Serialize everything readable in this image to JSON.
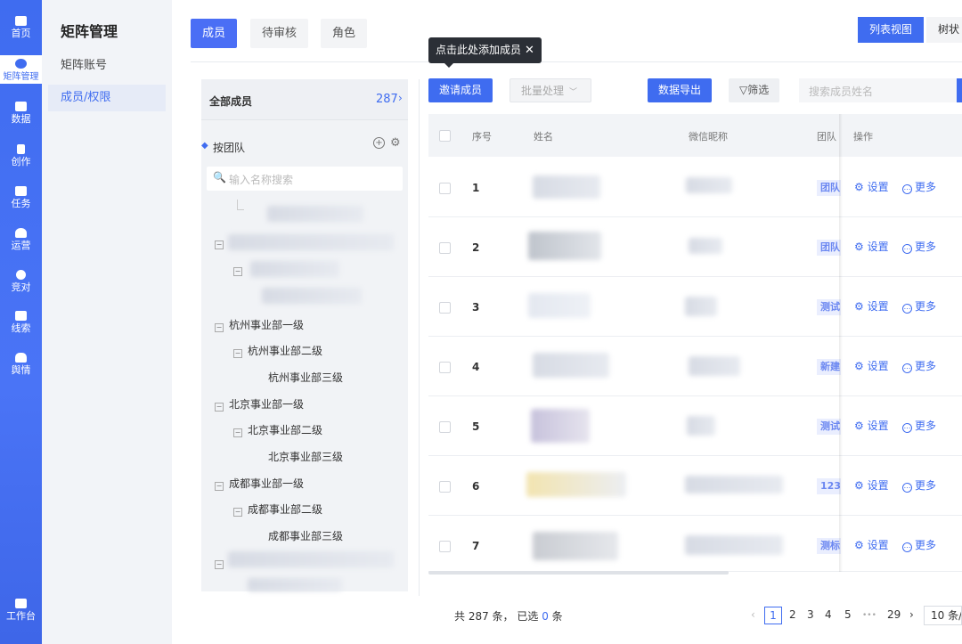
{
  "rail": {
    "items": [
      {
        "label": "首页",
        "icon": "home-icon"
      },
      {
        "label": "矩阵管理",
        "icon": "matrix-icon"
      },
      {
        "label": "数据",
        "icon": "data-icon"
      },
      {
        "label": "创作",
        "icon": "create-icon"
      },
      {
        "label": "任务",
        "icon": "task-icon"
      },
      {
        "label": "运营",
        "icon": "operation-icon"
      },
      {
        "label": "竞对",
        "icon": "compete-icon"
      },
      {
        "label": "线索",
        "icon": "leads-icon"
      },
      {
        "label": "舆情",
        "icon": "opinion-icon"
      }
    ],
    "workbench": "工作台"
  },
  "subnav": {
    "title": "矩阵管理",
    "items": [
      "矩阵账号",
      "成员/权限"
    ]
  },
  "tabs": [
    "成员",
    "待审核",
    "角色"
  ],
  "views": {
    "list": "列表视图",
    "tree": "树状视"
  },
  "tree": {
    "all_label": "全部成员",
    "all_count": "287",
    "group_label": "按团队",
    "search_placeholder": "输入名称搜索",
    "nodes": [
      "杭州事业部一级",
      "杭州事业部二级",
      "杭州事业部三级",
      "北京事业部一级",
      "北京事业部二级",
      "北京事业部三级",
      "成都事业部一级",
      "成都事业部二级",
      "成都事业部三级"
    ]
  },
  "tooltip": "点击此处添加成员",
  "toolbar": {
    "invite": "邀请成员",
    "batch": "批量处理",
    "export": "数据导出",
    "filter": "筛选",
    "search_placeholder": "搜索成员姓名"
  },
  "table": {
    "headers": {
      "index": "序号",
      "name": "姓名",
      "wechat": "微信昵称",
      "team": "团队",
      "ops": "操作"
    },
    "rows": [
      {
        "index": "1",
        "team": "团队"
      },
      {
        "index": "2",
        "team": "团队"
      },
      {
        "index": "3",
        "team": "测试"
      },
      {
        "index": "4",
        "team": "新建"
      },
      {
        "index": "5",
        "team": "测试"
      },
      {
        "index": "6",
        "team": "123"
      },
      {
        "index": "7",
        "team": "测标"
      }
    ],
    "action_settings": "设置",
    "action_more": "更多"
  },
  "footer": {
    "summary_prefix": "共 287 条，  已选",
    "selected": "0",
    "summary_suffix": "条",
    "pages": [
      "1",
      "2",
      "3",
      "4",
      "5",
      "•••",
      "29"
    ],
    "page_size": "10 条/"
  },
  "colors": {
    "accent": "#3f6cf0",
    "rail": "#4a74f6"
  }
}
